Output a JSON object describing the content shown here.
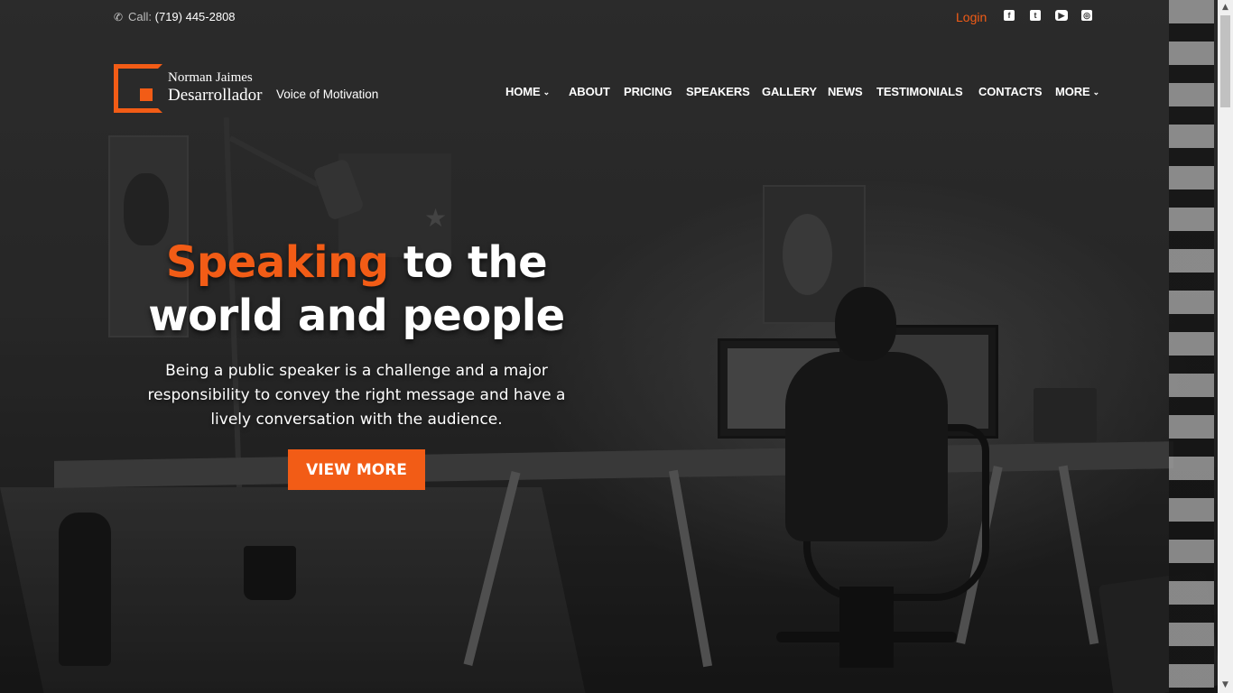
{
  "topbar": {
    "call_label": "Call:",
    "call_number": "(719) 445-2808",
    "login": "Login",
    "social": [
      {
        "icon": "facebook-icon",
        "glyph": "f"
      },
      {
        "icon": "twitter-icon",
        "glyph": "t"
      },
      {
        "icon": "youtube-icon",
        "glyph": "▶"
      },
      {
        "icon": "instagram-icon",
        "glyph": "◎"
      }
    ]
  },
  "brand": {
    "name_top": "Norman Jaimes",
    "name_bottom": "Desarrollador",
    "tagline": "Voice of Motivation"
  },
  "nav": {
    "items": [
      {
        "label": "HOME",
        "has_dropdown": true
      },
      {
        "label": "ABOUT",
        "has_dropdown": false
      },
      {
        "label": "PRICING",
        "has_dropdown": false
      },
      {
        "label": "SPEAKERS",
        "has_dropdown": false
      },
      {
        "label": "GALLERY",
        "has_dropdown": false
      },
      {
        "label": "NEWS",
        "has_dropdown": false
      },
      {
        "label": "TESTIMONIALS",
        "has_dropdown": false
      },
      {
        "label": "CONTACTS",
        "has_dropdown": false
      },
      {
        "label": "MORE",
        "has_dropdown": true
      }
    ]
  },
  "hero": {
    "title_accent": "Speaking",
    "title_rest_1": " to the",
    "title_rest_2": "world and people",
    "text": "Being a public speaker is a challenge and a major responsibility to convey the right message and have a lively conversation with the audience.",
    "cta": "VIEW MORE"
  },
  "colors": {
    "accent": "#f25c16",
    "text": "#ffffff"
  }
}
